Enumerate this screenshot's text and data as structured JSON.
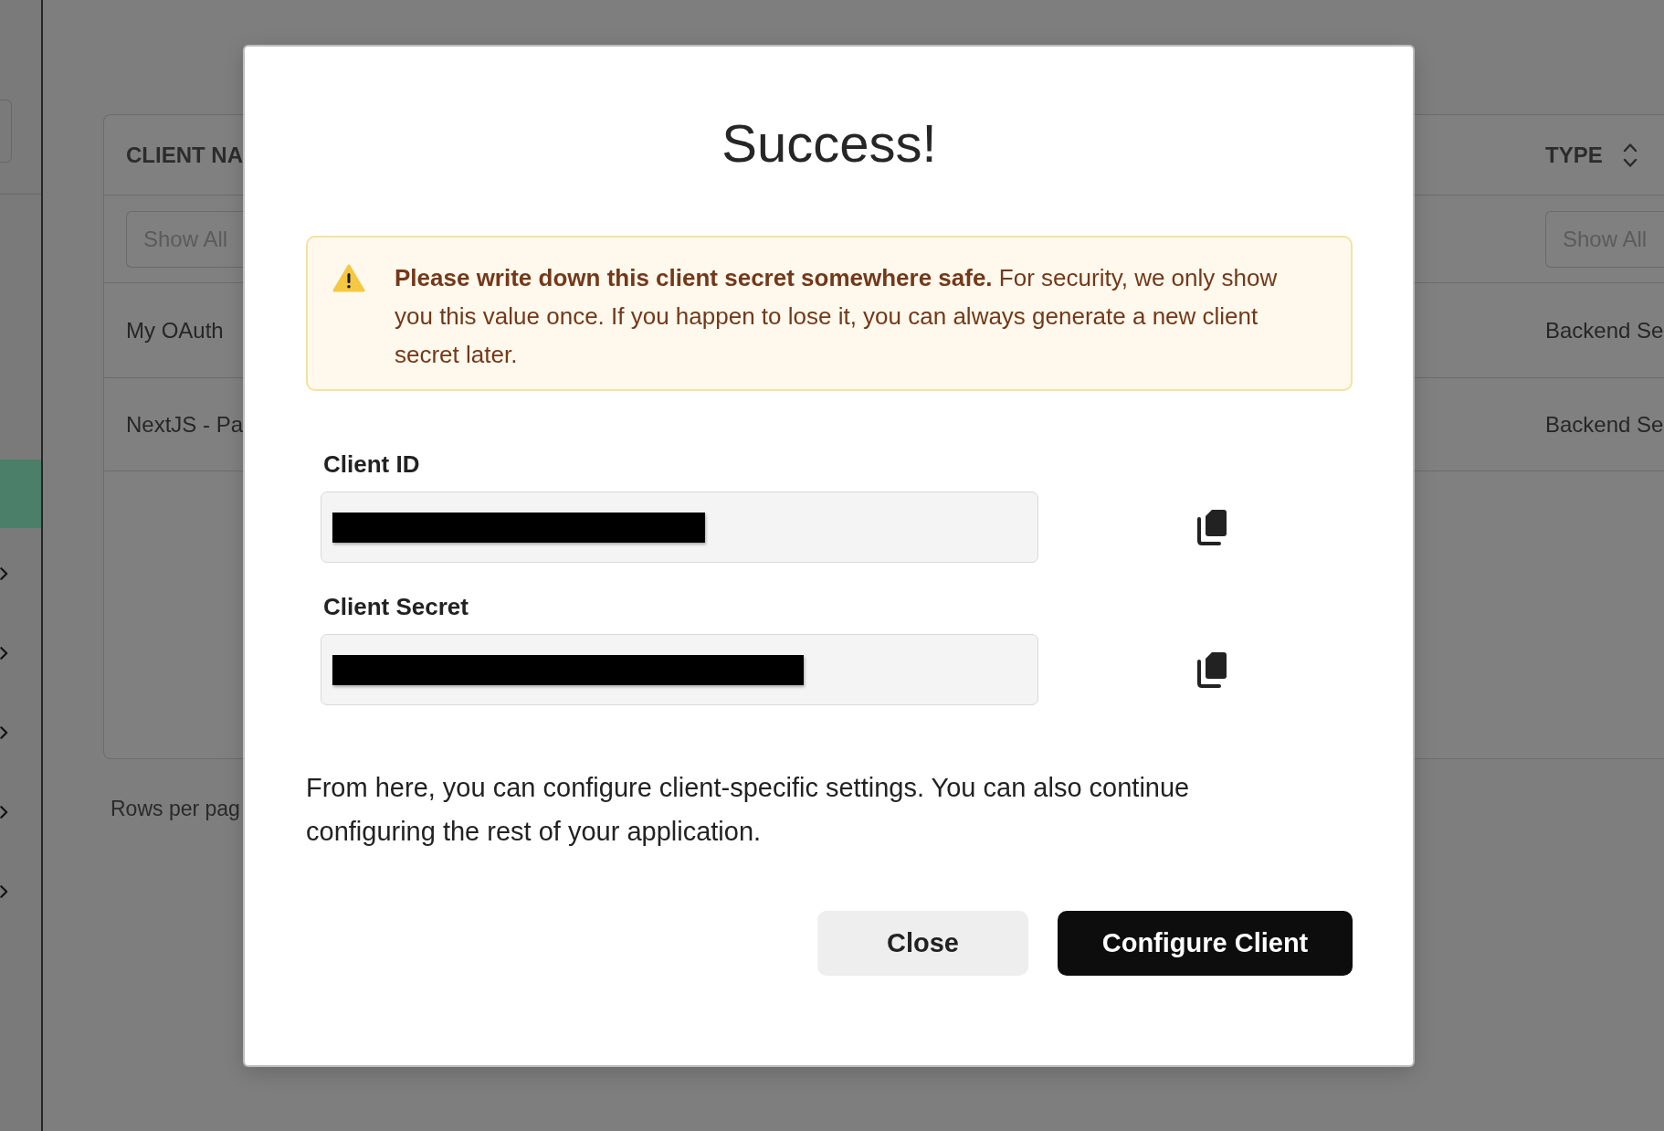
{
  "sidebar": {
    "items": [
      {
        "kind": "link",
        "selected": true
      },
      {
        "kind": "group",
        "selected": false,
        "expanded": false
      },
      {
        "kind": "group",
        "selected": false,
        "expanded": false
      },
      {
        "kind": "group",
        "selected": false,
        "expanded": false
      },
      {
        "kind": "group",
        "selected": false,
        "expanded": false
      },
      {
        "kind": "group",
        "selected": false,
        "expanded": false
      }
    ]
  },
  "table": {
    "columns": [
      {
        "label": "CLIENT NA",
        "filter": {
          "placeholder": "Show All"
        }
      },
      {
        "label": "TYPE",
        "sortable": true,
        "filter": {
          "placeholder": "Show All"
        }
      }
    ],
    "rows": [
      [
        "My OAuth",
        "Backend Se"
      ],
      [
        "NextJS - Pa",
        "Backend Se"
      ]
    ]
  },
  "pagination": {
    "label": "Rows per pag"
  },
  "dialog": {
    "title": "Success!",
    "alert": {
      "kind": "warning",
      "text": "**Please write down this client secret somewhere safe.** For security, we only show you this value once. If you happen to lose it, you can always generate a new client secret later."
    },
    "fields": [
      {
        "label": "Client ID",
        "redacted": true
      },
      {
        "label": "Client Secret",
        "redacted": true
      }
    ],
    "message": "From here, you can configure client-specific settings. You can also continue configuring the rest of your application.",
    "buttons": [
      {
        "label": "Close",
        "kind": "secondary"
      },
      {
        "label": "Configure Client",
        "kind": "primary"
      }
    ]
  }
}
